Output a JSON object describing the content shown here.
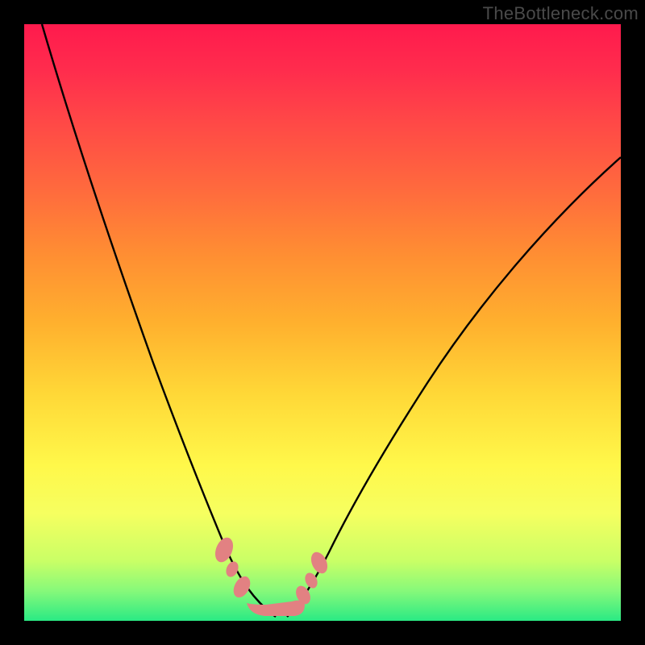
{
  "watermark": "TheBottleneck.com",
  "colors": {
    "frame": "#000000",
    "gradient_top": "#ff1a4d",
    "gradient_bottom": "#2aea84",
    "curve": "#000000",
    "blob": "#e28182"
  },
  "chart_data": {
    "type": "line",
    "title": "",
    "xlabel": "",
    "ylabel": "",
    "xlim": [
      0,
      100
    ],
    "ylim": [
      0,
      100
    ],
    "grid": false,
    "legend": false,
    "series": [
      {
        "name": "left-curve",
        "x": [
          3,
          6,
          9,
          12,
          15,
          18,
          21,
          24,
          27,
          30,
          33,
          34.5,
          36.5,
          38.5,
          40.5,
          42.5
        ],
        "values": [
          100,
          89,
          78,
          67,
          57,
          48,
          40,
          32,
          25,
          19,
          13,
          10,
          7.5,
          5,
          3,
          2
        ]
      },
      {
        "name": "right-curve",
        "x": [
          44,
          46,
          48,
          50,
          53,
          56,
          60,
          65,
          70,
          75,
          80,
          85,
          90,
          95,
          100
        ],
        "values": [
          2,
          3,
          5,
          7.5,
          11,
          16,
          22,
          30,
          38,
          46,
          53,
          60,
          66,
          72,
          78
        ]
      }
    ],
    "annotations": [
      {
        "name": "left-blob-upper",
        "x": 33.5,
        "y": 11
      },
      {
        "name": "left-blob-lower",
        "x": 36.0,
        "y": 6
      },
      {
        "name": "right-blob-upper",
        "x": 49.0,
        "y": 9
      },
      {
        "name": "right-blob-lower",
        "x": 47.0,
        "y": 5
      },
      {
        "name": "bottom-bridge",
        "x": 42.0,
        "y": 1.5
      }
    ]
  }
}
